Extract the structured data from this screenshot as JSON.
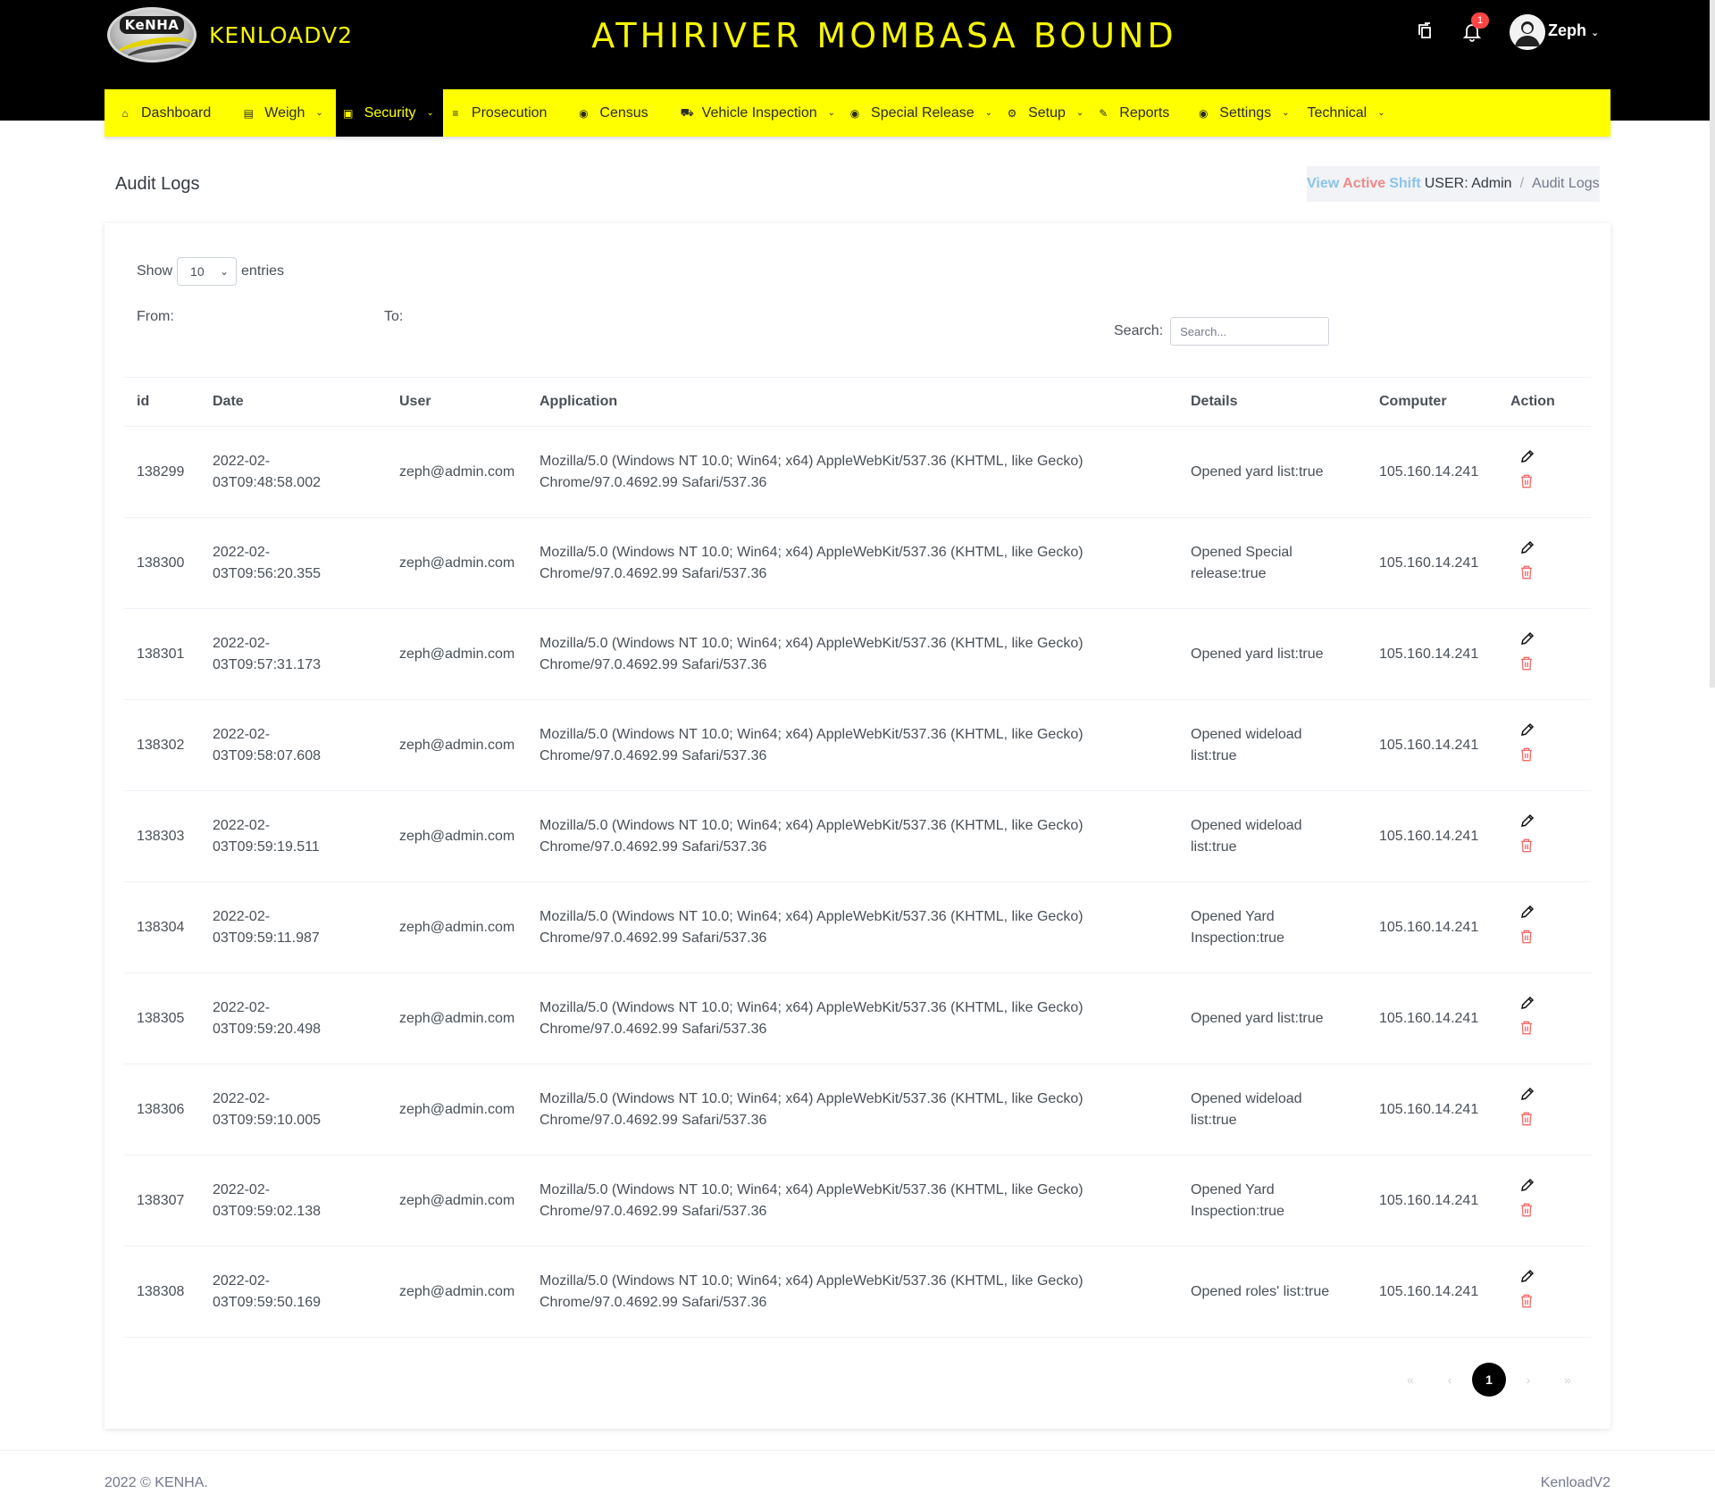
{
  "header": {
    "logo_badge_text": "KeNHA",
    "logo_text": "KENLOADV2",
    "station_title": "ATHIRIVER MOMBASA BOUND",
    "notification_count": "1",
    "user_name": "Zeph"
  },
  "nav": {
    "items": [
      {
        "label": "Dashboard",
        "icon": "home-icon",
        "has_dropdown": false,
        "active": false
      },
      {
        "label": "Weigh",
        "icon": "scale-icon",
        "has_dropdown": true,
        "active": false
      },
      {
        "label": "Security",
        "icon": "lock-icon",
        "has_dropdown": true,
        "active": true
      },
      {
        "label": "Prosecution",
        "icon": "list-icon",
        "has_dropdown": false,
        "active": false
      },
      {
        "label": "Census",
        "icon": "car-icon",
        "has_dropdown": false,
        "active": false
      },
      {
        "label": "Vehicle Inspection",
        "icon": "truck-icon",
        "has_dropdown": true,
        "active": false
      },
      {
        "label": "Special Release",
        "icon": "target-icon",
        "has_dropdown": true,
        "active": false
      },
      {
        "label": "Setup",
        "icon": "cogs-icon",
        "has_dropdown": true,
        "active": false
      },
      {
        "label": "Reports",
        "icon": "clip-icon",
        "has_dropdown": false,
        "active": false
      },
      {
        "label": "Settings",
        "icon": "target-icon",
        "has_dropdown": true,
        "active": false
      },
      {
        "label": "Technical",
        "icon": "",
        "has_dropdown": true,
        "active": false
      }
    ]
  },
  "page": {
    "title": "Audit Logs",
    "breadcrumb": {
      "view_text": "View",
      "active_text": "Active",
      "shift_text": "Shift",
      "user_text": "USER: Admin",
      "separator": "/",
      "current": "Audit Logs"
    }
  },
  "controls": {
    "show_label": "Show",
    "entries_value": "10",
    "entries_label": "entries",
    "from_label": "From:",
    "to_label": "To:",
    "search_label": "Search:",
    "search_placeholder": "Search...",
    "search_value": ""
  },
  "table": {
    "columns": [
      "id",
      "Date",
      "User",
      "Application",
      "Details",
      "Computer",
      "Action"
    ],
    "rows": [
      {
        "id": "138299",
        "date_line1": "2022-02-",
        "date_line2": "03T09:48:58.002",
        "user": "zeph@admin.com",
        "app_line1": "Mozilla/5.0 (Windows NT 10.0; Win64; x64) AppleWebKit/537.36 (KHTML, like Gecko)",
        "app_line2": "Chrome/97.0.4692.99 Safari/537.36",
        "details_line1": "Opened yard list:true",
        "details_line2": "",
        "computer": "105.160.14.241"
      },
      {
        "id": "138300",
        "date_line1": "2022-02-",
        "date_line2": "03T09:56:20.355",
        "user": "zeph@admin.com",
        "app_line1": "Mozilla/5.0 (Windows NT 10.0; Win64; x64) AppleWebKit/537.36 (KHTML, like Gecko)",
        "app_line2": "Chrome/97.0.4692.99 Safari/537.36",
        "details_line1": "Opened Special",
        "details_line2": "release:true",
        "computer": "105.160.14.241"
      },
      {
        "id": "138301",
        "date_line1": "2022-02-",
        "date_line2": "03T09:57:31.173",
        "user": "zeph@admin.com",
        "app_line1": "Mozilla/5.0 (Windows NT 10.0; Win64; x64) AppleWebKit/537.36 (KHTML, like Gecko)",
        "app_line2": "Chrome/97.0.4692.99 Safari/537.36",
        "details_line1": "Opened yard list:true",
        "details_line2": "",
        "computer": "105.160.14.241"
      },
      {
        "id": "138302",
        "date_line1": "2022-02-",
        "date_line2": "03T09:58:07.608",
        "user": "zeph@admin.com",
        "app_line1": "Mozilla/5.0 (Windows NT 10.0; Win64; x64) AppleWebKit/537.36 (KHTML, like Gecko)",
        "app_line2": "Chrome/97.0.4692.99 Safari/537.36",
        "details_line1": "Opened wideload",
        "details_line2": "list:true",
        "computer": "105.160.14.241"
      },
      {
        "id": "138303",
        "date_line1": "2022-02-",
        "date_line2": "03T09:59:19.511",
        "user": "zeph@admin.com",
        "app_line1": "Mozilla/5.0 (Windows NT 10.0; Win64; x64) AppleWebKit/537.36 (KHTML, like Gecko)",
        "app_line2": "Chrome/97.0.4692.99 Safari/537.36",
        "details_line1": "Opened wideload",
        "details_line2": "list:true",
        "computer": "105.160.14.241"
      },
      {
        "id": "138304",
        "date_line1": "2022-02-",
        "date_line2": "03T09:59:11.987",
        "user": "zeph@admin.com",
        "app_line1": "Mozilla/5.0 (Windows NT 10.0; Win64; x64) AppleWebKit/537.36 (KHTML, like Gecko)",
        "app_line2": "Chrome/97.0.4692.99 Safari/537.36",
        "details_line1": "Opened Yard",
        "details_line2": "Inspection:true",
        "computer": "105.160.14.241"
      },
      {
        "id": "138305",
        "date_line1": "2022-02-",
        "date_line2": "03T09:59:20.498",
        "user": "zeph@admin.com",
        "app_line1": "Mozilla/5.0 (Windows NT 10.0; Win64; x64) AppleWebKit/537.36 (KHTML, like Gecko)",
        "app_line2": "Chrome/97.0.4692.99 Safari/537.36",
        "details_line1": "Opened yard list:true",
        "details_line2": "",
        "computer": "105.160.14.241"
      },
      {
        "id": "138306",
        "date_line1": "2022-02-",
        "date_line2": "03T09:59:10.005",
        "user": "zeph@admin.com",
        "app_line1": "Mozilla/5.0 (Windows NT 10.0; Win64; x64) AppleWebKit/537.36 (KHTML, like Gecko)",
        "app_line2": "Chrome/97.0.4692.99 Safari/537.36",
        "details_line1": "Opened wideload",
        "details_line2": "list:true",
        "computer": "105.160.14.241"
      },
      {
        "id": "138307",
        "date_line1": "2022-02-",
        "date_line2": "03T09:59:02.138",
        "user": "zeph@admin.com",
        "app_line1": "Mozilla/5.0 (Windows NT 10.0; Win64; x64) AppleWebKit/537.36 (KHTML, like Gecko)",
        "app_line2": "Chrome/97.0.4692.99 Safari/537.36",
        "details_line1": "Opened Yard",
        "details_line2": "Inspection:true",
        "computer": "105.160.14.241"
      },
      {
        "id": "138308",
        "date_line1": "2022-02-",
        "date_line2": "03T09:59:50.169",
        "user": "zeph@admin.com",
        "app_line1": "Mozilla/5.0 (Windows NT 10.0; Win64; x64) AppleWebKit/537.36 (KHTML, like Gecko)",
        "app_line2": "Chrome/97.0.4692.99 Safari/537.36",
        "details_line1": "Opened roles' list:true",
        "details_line2": "",
        "computer": "105.160.14.241"
      }
    ]
  },
  "pagination": {
    "first": "«",
    "prev": "‹",
    "current_page": "1",
    "next": "›",
    "last": "»"
  },
  "footer": {
    "copyright": "2022 © KENHA.",
    "app_name": "KenloadV2"
  },
  "colors": {
    "header_bg": "#000000",
    "accent_yellow": "#ffff00",
    "delete_red": "#f46a6a",
    "breadcrumb_blue": "#8bc3ea",
    "breadcrumb_red": "#f08a8a"
  }
}
